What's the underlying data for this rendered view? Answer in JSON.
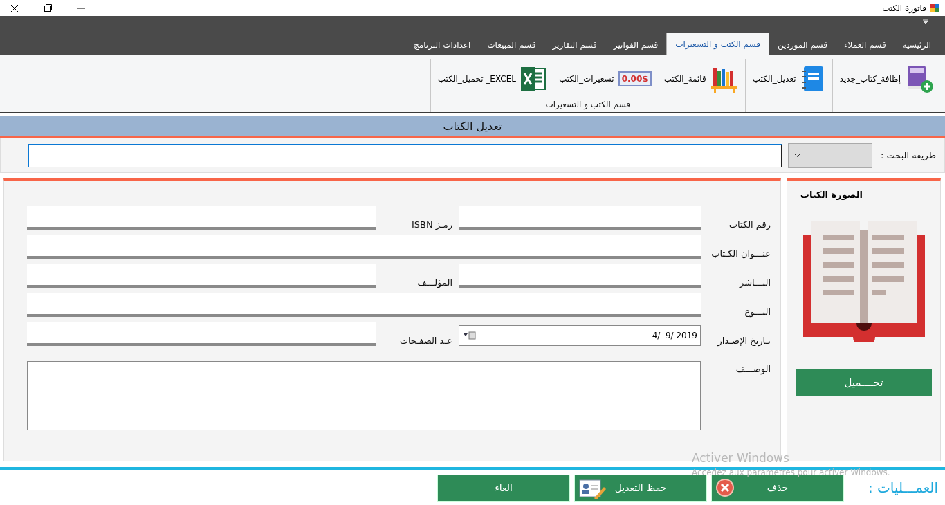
{
  "window": {
    "title": "فاتورة الكتب"
  },
  "ribbon": {
    "tabs": [
      {
        "label": "الرئيسية",
        "selected": false
      },
      {
        "label": "قسم العملاء",
        "selected": false
      },
      {
        "label": "قسم الموردين",
        "selected": false
      },
      {
        "label": "قسم الكتب و التسعيرات",
        "selected": true
      },
      {
        "label": "قسم الفواتير",
        "selected": false
      },
      {
        "label": "قسم التقارير",
        "selected": false
      },
      {
        "label": "قسم المبيعات",
        "selected": false
      },
      {
        "label": "اعدادات البرنامج",
        "selected": false
      }
    ],
    "groups": [
      {
        "buttons": [
          {
            "kind": "add_book",
            "label": "إظافة_كتاب_جديد"
          }
        ]
      },
      {
        "buttons": [
          {
            "kind": "notebook",
            "label": "تعديل_الكتب"
          }
        ]
      },
      {
        "label": "قسم الكتب و التسعيرات",
        "buttons": [
          {
            "kind": "shelf",
            "label": "قائمة_الكتب"
          },
          {
            "kind": "price",
            "label": "تسعيرات_الكتب",
            "badge": "0.00$"
          },
          {
            "kind": "excel",
            "label": "EXCEL_ تحميل_الكتب"
          }
        ]
      }
    ]
  },
  "header": {
    "title": "تعديل الكتاب"
  },
  "search": {
    "label": "طريقة البحث :"
  },
  "form": {
    "rows": [
      [
        {
          "label": "رقم الكتاب",
          "kind": "line"
        },
        {
          "label": "رمـز ISBN",
          "kind": "line"
        }
      ],
      [
        {
          "label": "عنـــوان الكـتاب",
          "kind": "line"
        }
      ],
      [
        {
          "label": "النـــاشر",
          "kind": "line"
        },
        {
          "label": "المؤلـــف",
          "kind": "line"
        }
      ],
      [
        {
          "label": "النـــوع",
          "kind": "line"
        }
      ],
      [
        {
          "label": "تـاريخ الإصـدار",
          "kind": "date",
          "value": "4/  9/ 2019"
        },
        {
          "label": "عـد الصفـحات",
          "kind": "line"
        }
      ],
      [
        {
          "label": "الوصـــف",
          "kind": "memo"
        }
      ]
    ]
  },
  "image_panel": {
    "title": "الصورة الكتاب",
    "button": "تحــــميل"
  },
  "actions": {
    "label": "العمـــليات :",
    "buttons": [
      {
        "kind": "delete",
        "label": "حذف"
      },
      {
        "kind": "save",
        "label": "حفظ التعديل"
      },
      {
        "kind": "cancel",
        "label": "الغاء"
      }
    ]
  },
  "windows_notice": {
    "title": "Activer Windows",
    "text": "Accedez aux parametres pour activer Windows."
  }
}
